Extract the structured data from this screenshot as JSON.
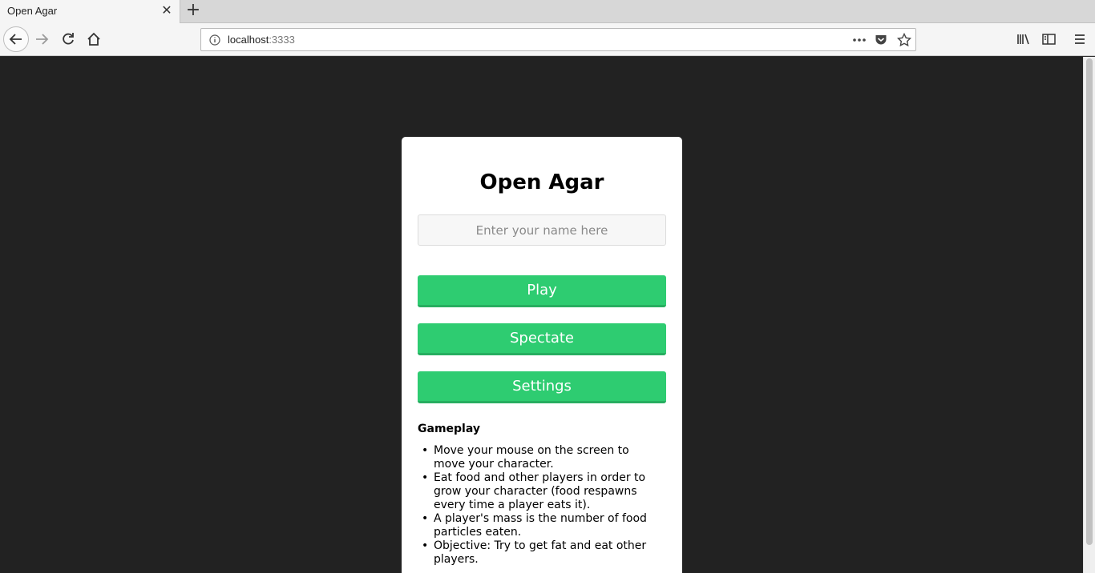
{
  "browser": {
    "tab_title": "Open Agar",
    "tab_close": "✕",
    "new_tab": "+",
    "url_host": "localhost",
    "url_port": ":3333"
  },
  "page": {
    "title": "Open Agar",
    "name_placeholder": "Enter your name here",
    "buttons": {
      "play": "Play",
      "spectate": "Spectate",
      "settings": "Settings"
    },
    "gameplay_heading": "Gameplay",
    "instructions": [
      "Move your mouse on the screen to move your character.",
      "Eat food and other players in order to grow your character (food respawns every time a player eats it).",
      "A player's mass is the number of food particles eaten.",
      "Objective: Try to get fat and eat other players."
    ]
  },
  "colors": {
    "background": "#222222",
    "button": "#2ecc71",
    "panel": "#ffffff"
  },
  "icons": [
    "back-arrow-icon",
    "forward-arrow-icon",
    "reload-icon",
    "home-icon",
    "info-icon",
    "more-actions-icon",
    "pocket-icon",
    "bookmark-star-icon",
    "library-icon",
    "sidebar-icon",
    "menu-icon"
  ]
}
